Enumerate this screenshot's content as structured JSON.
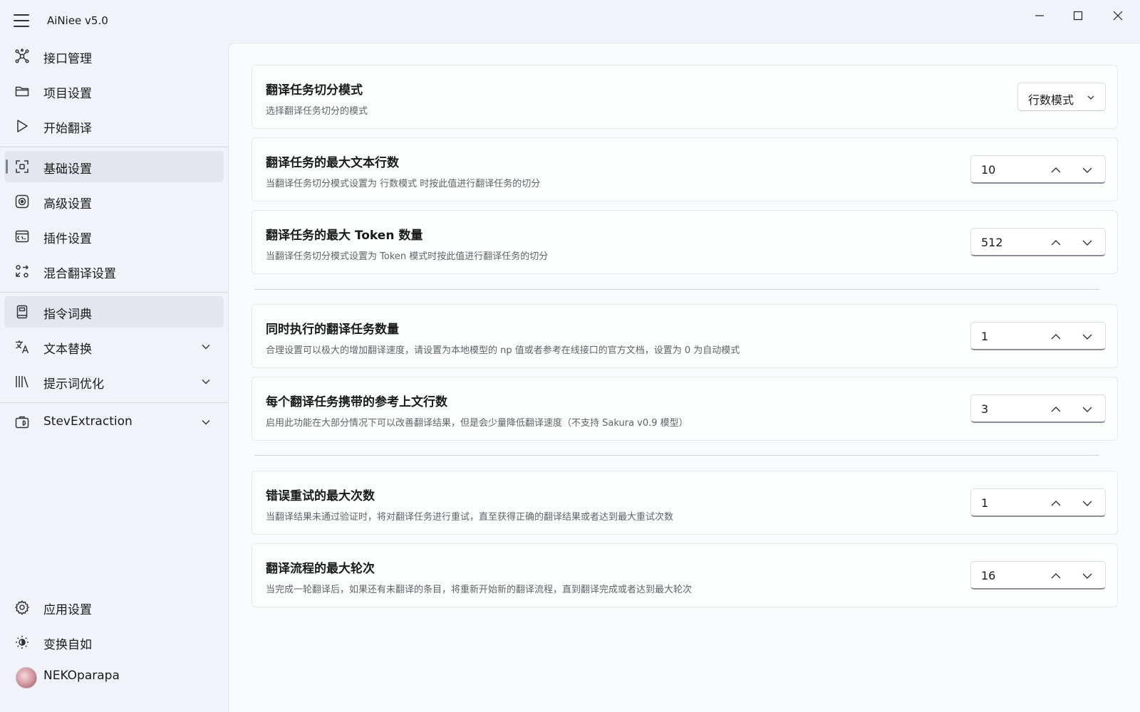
{
  "app": {
    "title": "AiNiee v5.0"
  },
  "sidebar": {
    "items": [
      {
        "label": "接口管理",
        "icon": "network-icon"
      },
      {
        "label": "项目设置",
        "icon": "folder-icon"
      },
      {
        "label": "开始翻译",
        "icon": "play-icon"
      },
      {
        "label": "基础设置",
        "icon": "layout-icon",
        "selected": true
      },
      {
        "label": "高级设置",
        "icon": "target-icon"
      },
      {
        "label": "插件设置",
        "icon": "terminal-icon"
      },
      {
        "label": "混合翻译设置",
        "icon": "shuffle-icon"
      },
      {
        "label": "指令词典",
        "icon": "book-icon"
      },
      {
        "label": "文本替换",
        "icon": "translate-icon",
        "expandable": true
      },
      {
        "label": "提示词优化",
        "icon": "library-icon",
        "expandable": true
      },
      {
        "label": "StevExtraction",
        "icon": "tool-icon",
        "expandable": true
      }
    ],
    "bottom": [
      {
        "label": "应用设置",
        "icon": "gear-icon"
      },
      {
        "label": "变换自如",
        "icon": "brightness-icon"
      },
      {
        "label": "NEKOparapa",
        "icon": "avatar"
      }
    ]
  },
  "settings": {
    "split_mode": {
      "title": "翻译任务切分模式",
      "desc": "选择翻译任务切分的模式",
      "value": "行数模式"
    },
    "max_lines": {
      "title": "翻译任务的最大文本行数",
      "desc": "当翻译任务切分模式设置为 行数模式 时按此值进行翻译任务的切分",
      "value": "10"
    },
    "max_tokens": {
      "title": "翻译任务的最大 Token 数量",
      "desc": "当翻译任务切分模式设置为 Token 模式时按此值进行翻译任务的切分",
      "value": "512"
    },
    "concurrency": {
      "title": "同时执行的翻译任务数量",
      "desc": "合理设置可以极大的增加翻译速度，请设置为本地模型的 np 值或者参考在线接口的官方文档，设置为 0 为自动模式",
      "value": "1"
    },
    "context_lines": {
      "title": "每个翻译任务携带的参考上文行数",
      "desc": "启用此功能在大部分情况下可以改善翻译结果，但是会少量降低翻译速度（不支持 Sakura v0.9 模型）",
      "value": "3"
    },
    "max_retries": {
      "title": "错误重试的最大次数",
      "desc": "当翻译结果未通过验证时，将对翻译任务进行重试，直至获得正确的翻译结果或者达到最大重试次数",
      "value": "1"
    },
    "max_rounds": {
      "title": "翻译流程的最大轮次",
      "desc": "当完成一轮翻译后，如果还有未翻译的条目，将重新开始新的翻译流程，直到翻译完成或者达到最大轮次",
      "value": "16"
    }
  }
}
